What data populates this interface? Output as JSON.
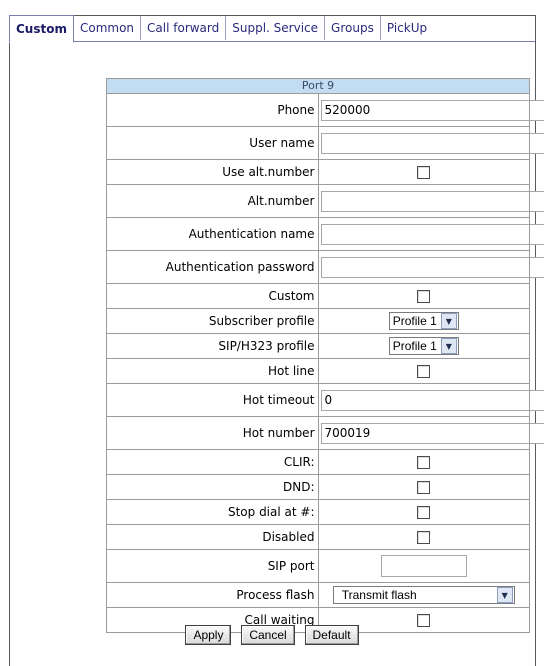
{
  "tabs": [
    "Custom",
    "Common",
    "Call forward",
    "Suppl. Service",
    "Groups",
    "PickUp"
  ],
  "active_tab": "Custom",
  "port_title": "Port 9",
  "rows": {
    "phone": {
      "label": "Phone",
      "value": "520000"
    },
    "user_name": {
      "label": "User name",
      "value": ""
    },
    "use_alt_number": {
      "label": "Use alt.number",
      "checked": false
    },
    "alt_number": {
      "label": "Alt.number",
      "value": ""
    },
    "auth_name": {
      "label": "Authentication name",
      "value": ""
    },
    "auth_password": {
      "label": "Authentication password",
      "value": ""
    },
    "custom": {
      "label": "Custom",
      "checked": false
    },
    "subscriber_profile": {
      "label": "Subscriber profile",
      "value": "Profile 1"
    },
    "sip_profile": {
      "label": "SIP/H323 profile",
      "value": "Profile 1"
    },
    "hot_line": {
      "label": "Hot line",
      "checked": false
    },
    "hot_timeout": {
      "label": "Hot timeout",
      "value": "0"
    },
    "hot_number": {
      "label": "Hot number",
      "value": "700019"
    },
    "clir": {
      "label": "CLIR:",
      "checked": false
    },
    "dnd": {
      "label": "DND:",
      "checked": false
    },
    "stop_dial": {
      "label": "Stop dial at #:",
      "checked": false
    },
    "disabled": {
      "label": "Disabled",
      "checked": false
    },
    "sip_port": {
      "label": "SIP port",
      "value": ""
    },
    "process_flash": {
      "label": "Process flash",
      "value": "Transmit flash"
    },
    "call_waiting": {
      "label": "Call waiting",
      "checked": false
    }
  },
  "buttons": {
    "apply": "Apply",
    "cancel": "Cancel",
    "default": "Default"
  }
}
